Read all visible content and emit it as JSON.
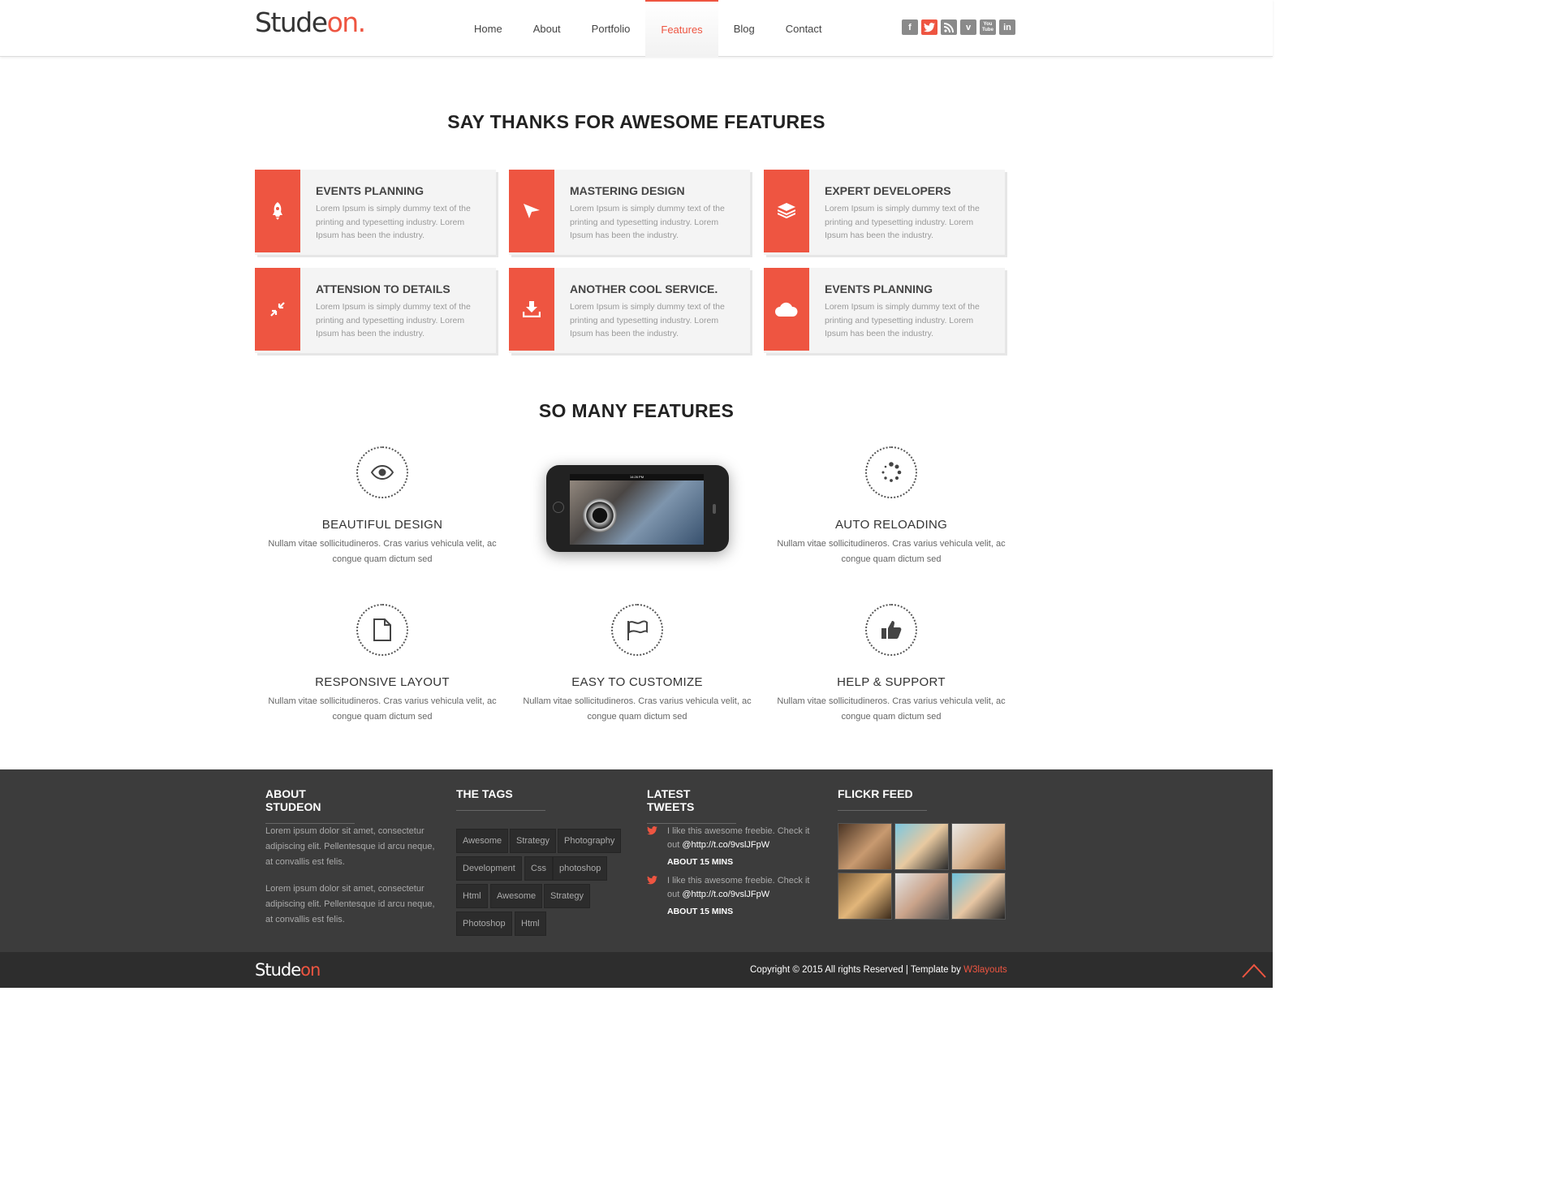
{
  "header": {
    "logo_main": "Stude",
    "logo_accent": "on.",
    "nav": [
      {
        "label": "Home"
      },
      {
        "label": "About"
      },
      {
        "label": "Portfolio"
      },
      {
        "label": "Features",
        "active": true
      },
      {
        "label": "Blog"
      },
      {
        "label": "Contact"
      }
    ],
    "social": [
      {
        "icon": "facebook-icon",
        "glyph": "f"
      },
      {
        "icon": "twitter-icon",
        "glyph": "t"
      },
      {
        "icon": "rss-icon",
        "glyph": "≋"
      },
      {
        "icon": "vimeo-icon",
        "glyph": "v"
      },
      {
        "icon": "youtube-icon",
        "glyph": "You Tube"
      },
      {
        "icon": "linkedin-icon",
        "glyph": "in"
      }
    ]
  },
  "awesome": {
    "title": "SAY THANKS FOR AWESOME FEATURES",
    "cards": [
      {
        "title": "EVENTS PLANNING",
        "text": "Lorem Ipsum is simply dummy text of the printing and typesetting industry. Lorem Ipsum has been the industry.",
        "icon": "rocket-icon"
      },
      {
        "title": "MASTERING DESIGN",
        "text": "Lorem Ipsum is simply dummy text of the printing and typesetting industry. Lorem Ipsum has been the industry.",
        "icon": "paper-plane-icon"
      },
      {
        "title": "EXPERT DEVELOPERS",
        "text": "Lorem Ipsum is simply dummy text of the printing and typesetting industry. Lorem Ipsum has been the industry.",
        "icon": "layers-icon"
      },
      {
        "title": "ATTENSION TO DETAILS",
        "text": "Lorem Ipsum is simply dummy text of the printing and typesetting industry. Lorem Ipsum has been the industry.",
        "icon": "compress-icon"
      },
      {
        "title": "ANOTHER COOL SERVICE.",
        "text": "Lorem Ipsum is simply dummy text of the printing and typesetting industry. Lorem Ipsum has been the industry.",
        "icon": "download-icon"
      },
      {
        "title": "EVENTS PLANNING",
        "text": "Lorem Ipsum is simply dummy text of the printing and typesetting industry. Lorem Ipsum has been the industry.",
        "icon": "cloud-icon"
      }
    ]
  },
  "many": {
    "title": "SO MANY FEATURES",
    "features": [
      {
        "title": "BEAUTIFUL DESIGN",
        "text": "Nullam vitae sollicitudineros. Cras varius vehicula velit, ac congue quam dictum sed",
        "icon": "eye-icon"
      },
      {
        "title": "AUTO RELOADING",
        "text": "Nullam vitae sollicitudineros. Cras varius vehicula velit, ac congue quam dictum sed",
        "icon": "spinner-icon"
      },
      {
        "title": "RESPONSIVE LAYOUT",
        "text": "Nullam vitae sollicitudineros. Cras varius vehicula velit, ac congue quam dictum sed",
        "icon": "document-icon"
      },
      {
        "title": "EASY TO CUSTOMIZE",
        "text": "Nullam vitae sollicitudineros. Cras varius vehicula velit, ac congue quam dictum sed",
        "icon": "flag-icon"
      },
      {
        "title": "HELP & SUPPORT",
        "text": "Nullam vitae sollicitudineros. Cras varius vehicula velit, ac congue quam dictum sed",
        "icon": "thumbs-up-icon"
      }
    ],
    "phone_time": "14:26 PM"
  },
  "footer": {
    "about_title": "ABOUT STUDEON",
    "about_p1": "Lorem ipsum dolor sit amet, consectetur adipiscing elit. Pellentesque id arcu neque, at convallis est felis.",
    "about_p2": "Lorem ipsum dolor sit amet, consectetur adipiscing elit. Pellentesque id arcu neque, at convallis est felis.",
    "tags_title": "THE TAGS",
    "tags": [
      "Awesome",
      "Strategy",
      "Photography",
      "Development",
      "Css",
      "photoshop",
      "Html",
      "Awesome",
      "Strategy",
      "Photoshop",
      "Html"
    ],
    "tweets_title": "LATEST TWEETS",
    "tweets": [
      {
        "text": "I like this awesome freebie. Check it out ",
        "link": "@http://t.co/9vslJFpW",
        "time": "ABOUT 15 MINS"
      },
      {
        "text": "I like this awesome freebie. Check it out ",
        "link": "@http://t.co/9vslJFpW",
        "time": "ABOUT 15 MINS"
      }
    ],
    "flickr_title": "FLICKR FEED"
  },
  "bottom": {
    "logo_main": "Stude",
    "logo_accent": "on",
    "copyright": "Copyright © 2015 All rights Reserved | Template by ",
    "credit": "W3layouts"
  },
  "colors": {
    "accent": "#ee5541",
    "footer": "#3c3c3c",
    "bottom": "#2d2d2d"
  }
}
